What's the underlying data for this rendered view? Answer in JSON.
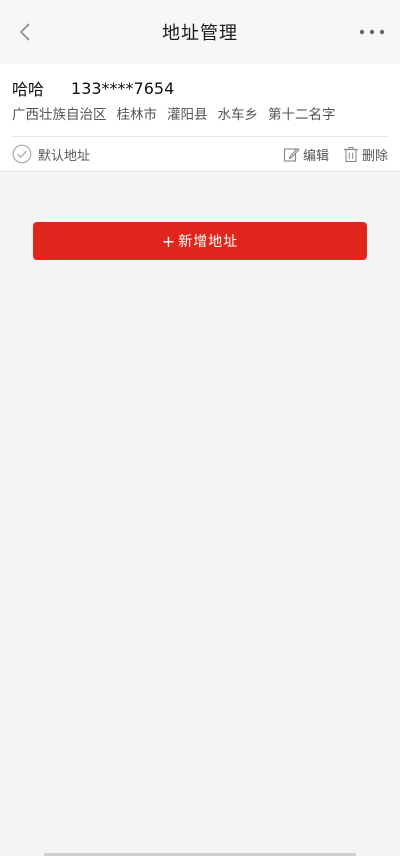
{
  "navbar": {
    "title": "地址管理",
    "back_icon": "chevron-left-icon",
    "more_icon": "more-dots-icon"
  },
  "address": {
    "name": "哈哈",
    "phone": "133****7654",
    "province": "广西壮族自治区",
    "city": "桂林市",
    "county": "灌阳县",
    "town": "水车乡",
    "detail": "第十二名字",
    "default_label": "默认地址",
    "edit_label": "编辑",
    "delete_label": "删除"
  },
  "add_button": {
    "plus": "+",
    "label": "新增地址"
  },
  "colors": {
    "accent": "#e0261c",
    "background": "#f4f4f4"
  }
}
